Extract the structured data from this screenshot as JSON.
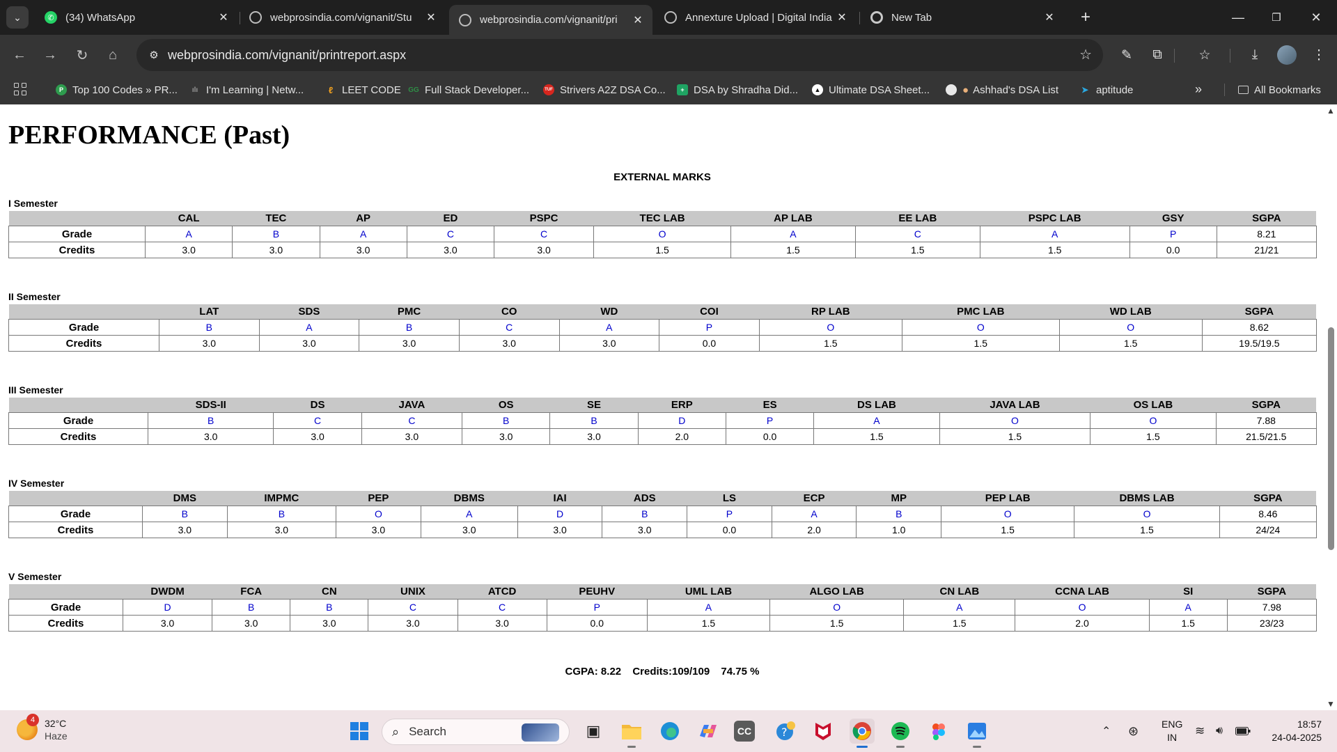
{
  "browser": {
    "tabs": [
      {
        "title": "(34) WhatsApp",
        "icon": "whatsapp-icon",
        "active": false
      },
      {
        "title": "webprosindia.com/vignanit/Stu",
        "icon": "globe-icon",
        "active": false
      },
      {
        "title": "webprosindia.com/vignanit/pri",
        "icon": "globe-icon",
        "active": true
      },
      {
        "title": "Annexture Upload | Digital India",
        "icon": "globe-icon",
        "active": false
      },
      {
        "title": "New Tab",
        "icon": "chrome-icon",
        "active": false
      }
    ],
    "url": "webprosindia.com/vignanit/printreport.aspx",
    "bookmarks": [
      {
        "label": "Top 100 Codes » PR...",
        "icon": "green-p-icon",
        "color": "#2e9c4e"
      },
      {
        "label": "I'm Learning | Netw...",
        "icon": "cisco-icon",
        "color": "#6a6a6a"
      },
      {
        "label": "LEET CODE",
        "icon": "leetcode-icon",
        "color": "#f0a020"
      },
      {
        "label": "Full Stack Developer...",
        "icon": "gfg-icon",
        "color": "#2f8d46"
      },
      {
        "label": "Strivers A2Z DSA Co...",
        "icon": "tuf-icon",
        "color": "#d7261e"
      },
      {
        "label": "DSA by Shradha Did...",
        "icon": "sheets-icon",
        "color": "#1fa463"
      },
      {
        "label": "Ultimate DSA Sheet...",
        "icon": "triangle-icon",
        "color": "#111111"
      },
      {
        "label": "Ashhad's DSA List",
        "icon": "notion-icon",
        "color": "#e8e8e8"
      },
      {
        "label": "aptitude",
        "icon": "bookmark-icon",
        "color": "#2aa8e0"
      }
    ],
    "all_bookmarks": "All Bookmarks"
  },
  "page": {
    "title": "PERFORMANCE (Past)",
    "section_heading": "EXTERNAL MARKS",
    "row_labels": {
      "grade": "Grade",
      "credits": "Credits"
    },
    "semesters": [
      {
        "label": "I Semester",
        "subjects": [
          "CAL",
          "TEC",
          "AP",
          "ED",
          "PSPC",
          "TEC LAB",
          "AP LAB",
          "EE LAB",
          "PSPC LAB",
          "GSY",
          "SGPA"
        ],
        "grades": [
          "A",
          "B",
          "A",
          "C",
          "C",
          "O",
          "A",
          "C",
          "A",
          "P",
          "8.21"
        ],
        "credits": [
          "3.0",
          "3.0",
          "3.0",
          "3.0",
          "3.0",
          "1.5",
          "1.5",
          "1.5",
          "1.5",
          "0.0",
          "21/21"
        ]
      },
      {
        "label": "II Semester",
        "subjects": [
          "LAT",
          "SDS",
          "PMC",
          "CO",
          "WD",
          "COI",
          "RP LAB",
          "PMC LAB",
          "WD LAB",
          "SGPA"
        ],
        "grades": [
          "B",
          "A",
          "B",
          "C",
          "A",
          "P",
          "O",
          "O",
          "O",
          "8.62"
        ],
        "credits": [
          "3.0",
          "3.0",
          "3.0",
          "3.0",
          "3.0",
          "0.0",
          "1.5",
          "1.5",
          "1.5",
          "19.5/19.5"
        ]
      },
      {
        "label": "III Semester",
        "subjects": [
          "SDS-II",
          "DS",
          "JAVA",
          "OS",
          "SE",
          "ERP",
          "ES",
          "DS LAB",
          "JAVA LAB",
          "OS LAB",
          "SGPA"
        ],
        "grades": [
          "B",
          "C",
          "C",
          "B",
          "B",
          "D",
          "P",
          "A",
          "O",
          "O",
          "7.88"
        ],
        "credits": [
          "3.0",
          "3.0",
          "3.0",
          "3.0",
          "3.0",
          "2.0",
          "0.0",
          "1.5",
          "1.5",
          "1.5",
          "21.5/21.5"
        ]
      },
      {
        "label": "IV Semester",
        "subjects": [
          "DMS",
          "IMPMC",
          "PEP",
          "DBMS",
          "IAI",
          "ADS",
          "LS",
          "ECP",
          "MP",
          "PEP LAB",
          "DBMS LAB",
          "SGPA"
        ],
        "grades": [
          "B",
          "B",
          "O",
          "A",
          "D",
          "B",
          "P",
          "A",
          "B",
          "O",
          "O",
          "8.46"
        ],
        "credits": [
          "3.0",
          "3.0",
          "3.0",
          "3.0",
          "3.0",
          "3.0",
          "0.0",
          "2.0",
          "1.0",
          "1.5",
          "1.5",
          "24/24"
        ]
      },
      {
        "label": "V Semester",
        "subjects": [
          "DWDM",
          "FCA",
          "CN",
          "UNIX",
          "ATCD",
          "PEUHV",
          "UML LAB",
          "ALGO LAB",
          "CN LAB",
          "CCNA LAB",
          "SI",
          "SGPA"
        ],
        "grades": [
          "D",
          "B",
          "B",
          "C",
          "C",
          "P",
          "A",
          "O",
          "A",
          "O",
          "A",
          "7.98"
        ],
        "credits": [
          "3.0",
          "3.0",
          "3.0",
          "3.0",
          "3.0",
          "0.0",
          "1.5",
          "1.5",
          "1.5",
          "2.0",
          "1.5",
          "23/23"
        ]
      }
    ],
    "summary": {
      "cgpa": "CGPA: 8.22",
      "credits": "Credits:109/109",
      "percent": "74.75 %"
    }
  },
  "taskbar": {
    "weather": {
      "temp": "32°C",
      "condition": "Haze",
      "badge": "4"
    },
    "search_label": "Search",
    "apps": [
      "windows-start-icon",
      "task-view-icon",
      "file-explorer-icon",
      "edge-icon",
      "copilot-icon",
      "cc-icon",
      "help-icon",
      "mcafee-icon",
      "chrome-icon",
      "spotify-icon",
      "figma-icon",
      "photos-icon"
    ],
    "lang": {
      "line1": "ENG",
      "line2": "IN"
    },
    "time": "18:57",
    "date": "24-04-2025"
  }
}
